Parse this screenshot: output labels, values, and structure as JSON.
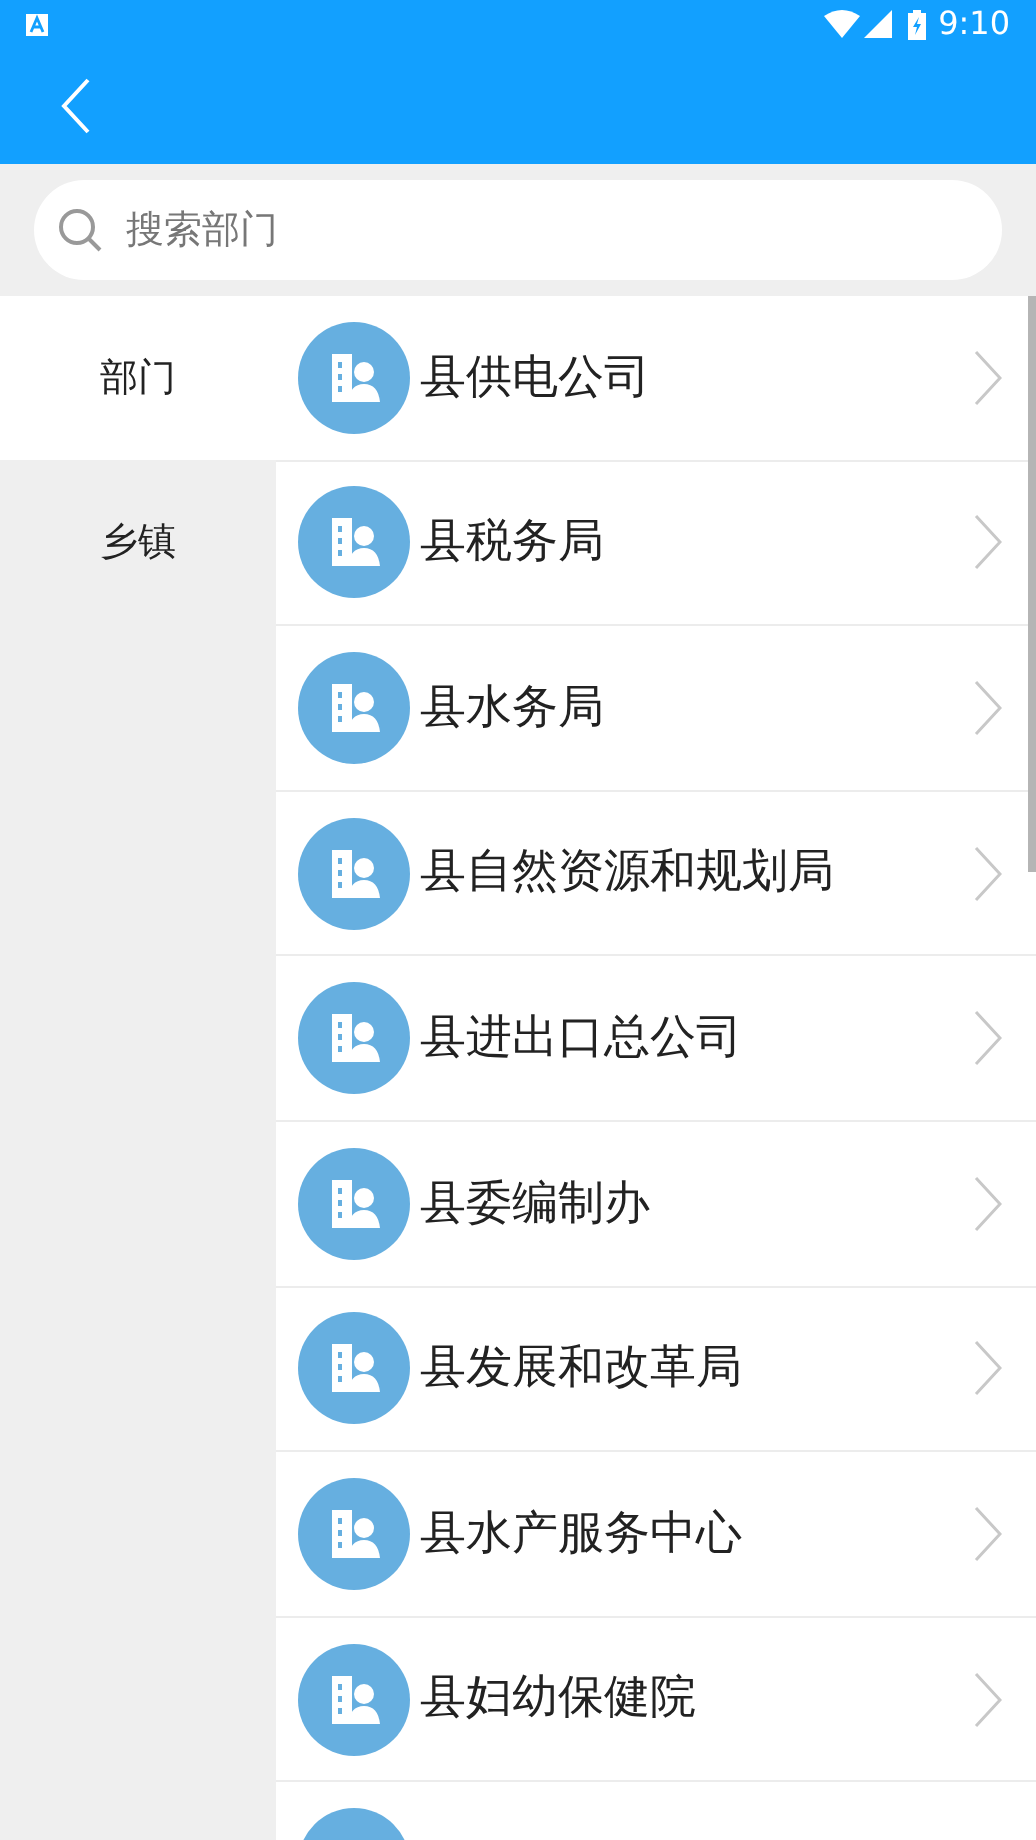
{
  "status_bar": {
    "time": "9:10"
  },
  "search": {
    "placeholder": "搜索部门"
  },
  "sidebar": {
    "items": [
      {
        "label": "部门",
        "selected": true
      },
      {
        "label": "乡镇",
        "selected": false
      }
    ]
  },
  "departments": [
    {
      "name": "县供电公司"
    },
    {
      "name": "县税务局"
    },
    {
      "name": "县水务局"
    },
    {
      "name": "县自然资源和规划局"
    },
    {
      "name": "县进出口总公司"
    },
    {
      "name": "县委编制办"
    },
    {
      "name": "县发展和改革局"
    },
    {
      "name": "县水产服务中心"
    },
    {
      "name": "县妇幼保健院"
    }
  ]
}
